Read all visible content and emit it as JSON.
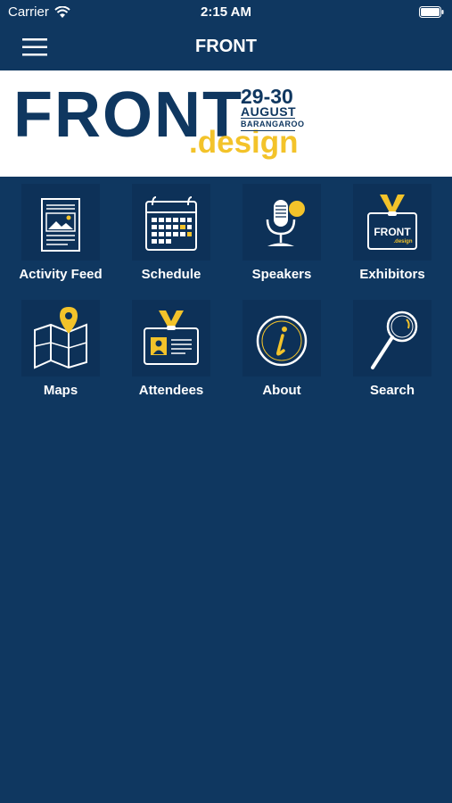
{
  "status_bar": {
    "carrier": "Carrier",
    "time": "2:15 AM"
  },
  "nav": {
    "title": "FRONT"
  },
  "banner": {
    "logo_word": "FRONT",
    "logo_suffix": ".design",
    "dates": "29-30",
    "month": "AUGUST",
    "venue": "BARANGAROO"
  },
  "colors": {
    "background": "#0f3760",
    "tile": "#0d3158",
    "accent": "#f3c32a"
  },
  "tiles": [
    {
      "label": "Activity Feed",
      "icon": "newspaper-icon"
    },
    {
      "label": "Schedule",
      "icon": "calendar-icon"
    },
    {
      "label": "Speakers",
      "icon": "microphone-icon"
    },
    {
      "label": "Exhibitors",
      "icon": "badge-icon"
    },
    {
      "label": "Maps",
      "icon": "map-icon"
    },
    {
      "label": "Attendees",
      "icon": "id-card-icon"
    },
    {
      "label": "About",
      "icon": "info-icon"
    },
    {
      "label": "Search",
      "icon": "magnifier-icon"
    }
  ],
  "exhibitor_badge": {
    "word": "FRONT",
    "suffix": ".design"
  }
}
